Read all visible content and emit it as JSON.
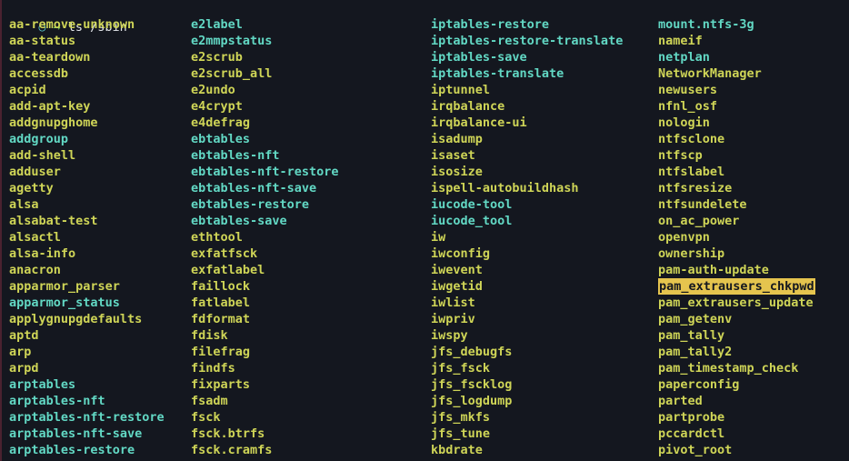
{
  "terminal": {
    "background_color": "#14171f",
    "exec_color": "#cfd557",
    "symlink_color": "#62d8c4",
    "highlight_bg_color": "#e5c44e",
    "highlight_fg_color": "#14171f",
    "prompt": {
      "circle_icon": "○",
      "arrow_icon": "→",
      "command": "ls /sbin"
    },
    "columns": [
      {
        "index": 0,
        "entries": [
          {
            "name": "aa-remove-unknown",
            "type": "exec"
          },
          {
            "name": "aa-status",
            "type": "exec"
          },
          {
            "name": "aa-teardown",
            "type": "exec"
          },
          {
            "name": "accessdb",
            "type": "exec"
          },
          {
            "name": "acpid",
            "type": "exec"
          },
          {
            "name": "add-apt-key",
            "type": "exec"
          },
          {
            "name": "addgnupghome",
            "type": "exec"
          },
          {
            "name": "addgroup",
            "type": "link"
          },
          {
            "name": "add-shell",
            "type": "exec"
          },
          {
            "name": "adduser",
            "type": "exec"
          },
          {
            "name": "agetty",
            "type": "exec"
          },
          {
            "name": "alsa",
            "type": "exec"
          },
          {
            "name": "alsabat-test",
            "type": "exec"
          },
          {
            "name": "alsactl",
            "type": "exec"
          },
          {
            "name": "alsa-info",
            "type": "exec"
          },
          {
            "name": "anacron",
            "type": "exec"
          },
          {
            "name": "apparmor_parser",
            "type": "exec"
          },
          {
            "name": "apparmor_status",
            "type": "link"
          },
          {
            "name": "applygnupgdefaults",
            "type": "exec"
          },
          {
            "name": "aptd",
            "type": "exec"
          },
          {
            "name": "arp",
            "type": "exec"
          },
          {
            "name": "arpd",
            "type": "exec"
          },
          {
            "name": "arptables",
            "type": "link"
          },
          {
            "name": "arptables-nft",
            "type": "link"
          },
          {
            "name": "arptables-nft-restore",
            "type": "link"
          },
          {
            "name": "arptables-nft-save",
            "type": "link"
          },
          {
            "name": "arptables-restore",
            "type": "link"
          }
        ]
      },
      {
        "index": 1,
        "entries": [
          {
            "name": "e2label",
            "type": "link"
          },
          {
            "name": "e2mmpstatus",
            "type": "link"
          },
          {
            "name": "e2scrub",
            "type": "exec"
          },
          {
            "name": "e2scrub_all",
            "type": "exec"
          },
          {
            "name": "e2undo",
            "type": "exec"
          },
          {
            "name": "e4crypt",
            "type": "exec"
          },
          {
            "name": "e4defrag",
            "type": "exec"
          },
          {
            "name": "ebtables",
            "type": "link"
          },
          {
            "name": "ebtables-nft",
            "type": "link"
          },
          {
            "name": "ebtables-nft-restore",
            "type": "link"
          },
          {
            "name": "ebtables-nft-save",
            "type": "link"
          },
          {
            "name": "ebtables-restore",
            "type": "link"
          },
          {
            "name": "ebtables-save",
            "type": "link"
          },
          {
            "name": "ethtool",
            "type": "exec"
          },
          {
            "name": "exfatfsck",
            "type": "exec"
          },
          {
            "name": "exfatlabel",
            "type": "exec"
          },
          {
            "name": "faillock",
            "type": "exec"
          },
          {
            "name": "fatlabel",
            "type": "exec"
          },
          {
            "name": "fdformat",
            "type": "exec"
          },
          {
            "name": "fdisk",
            "type": "exec"
          },
          {
            "name": "filefrag",
            "type": "exec"
          },
          {
            "name": "findfs",
            "type": "exec"
          },
          {
            "name": "fixparts",
            "type": "exec"
          },
          {
            "name": "fsadm",
            "type": "exec"
          },
          {
            "name": "fsck",
            "type": "exec"
          },
          {
            "name": "fsck.btrfs",
            "type": "exec"
          },
          {
            "name": "fsck.cramfs",
            "type": "exec"
          }
        ]
      },
      {
        "index": 2,
        "entries": [
          {
            "name": "iptables-restore",
            "type": "link"
          },
          {
            "name": "iptables-restore-translate",
            "type": "link"
          },
          {
            "name": "iptables-save",
            "type": "link"
          },
          {
            "name": "iptables-translate",
            "type": "link"
          },
          {
            "name": "iptunnel",
            "type": "exec"
          },
          {
            "name": "irqbalance",
            "type": "exec"
          },
          {
            "name": "irqbalance-ui",
            "type": "exec"
          },
          {
            "name": "isadump",
            "type": "exec"
          },
          {
            "name": "isaset",
            "type": "exec"
          },
          {
            "name": "isosize",
            "type": "exec"
          },
          {
            "name": "ispell-autobuildhash",
            "type": "exec"
          },
          {
            "name": "iucode-tool",
            "type": "link"
          },
          {
            "name": "iucode_tool",
            "type": "link"
          },
          {
            "name": "iw",
            "type": "exec"
          },
          {
            "name": "iwconfig",
            "type": "exec"
          },
          {
            "name": "iwevent",
            "type": "exec"
          },
          {
            "name": "iwgetid",
            "type": "exec"
          },
          {
            "name": "iwlist",
            "type": "exec"
          },
          {
            "name": "iwpriv",
            "type": "exec"
          },
          {
            "name": "iwspy",
            "type": "exec"
          },
          {
            "name": "jfs_debugfs",
            "type": "exec"
          },
          {
            "name": "jfs_fsck",
            "type": "exec"
          },
          {
            "name": "jfs_fscklog",
            "type": "exec"
          },
          {
            "name": "jfs_logdump",
            "type": "exec"
          },
          {
            "name": "jfs_mkfs",
            "type": "exec"
          },
          {
            "name": "jfs_tune",
            "type": "exec"
          },
          {
            "name": "kbdrate",
            "type": "exec"
          }
        ]
      },
      {
        "index": 3,
        "entries": [
          {
            "name": "mount.ntfs-3g",
            "type": "link"
          },
          {
            "name": "nameif",
            "type": "exec"
          },
          {
            "name": "netplan",
            "type": "link"
          },
          {
            "name": "NetworkManager",
            "type": "exec"
          },
          {
            "name": "newusers",
            "type": "exec"
          },
          {
            "name": "nfnl_osf",
            "type": "exec"
          },
          {
            "name": "nologin",
            "type": "exec"
          },
          {
            "name": "ntfsclone",
            "type": "exec"
          },
          {
            "name": "ntfscp",
            "type": "exec"
          },
          {
            "name": "ntfslabel",
            "type": "exec"
          },
          {
            "name": "ntfsresize",
            "type": "exec"
          },
          {
            "name": "ntfsundelete",
            "type": "exec"
          },
          {
            "name": "on_ac_power",
            "type": "exec"
          },
          {
            "name": "openvpn",
            "type": "exec"
          },
          {
            "name": "ownership",
            "type": "exec"
          },
          {
            "name": "pam-auth-update",
            "type": "exec"
          },
          {
            "name": "pam_extrausers_chkpwd",
            "type": "selected"
          },
          {
            "name": "pam_extrausers_update",
            "type": "exec"
          },
          {
            "name": "pam_getenv",
            "type": "exec"
          },
          {
            "name": "pam_tally",
            "type": "exec"
          },
          {
            "name": "pam_tally2",
            "type": "exec"
          },
          {
            "name": "pam_timestamp_check",
            "type": "exec"
          },
          {
            "name": "paperconfig",
            "type": "exec"
          },
          {
            "name": "parted",
            "type": "exec"
          },
          {
            "name": "partprobe",
            "type": "exec"
          },
          {
            "name": "pccardctl",
            "type": "exec"
          },
          {
            "name": "pivot_root",
            "type": "exec"
          }
        ]
      }
    ]
  }
}
